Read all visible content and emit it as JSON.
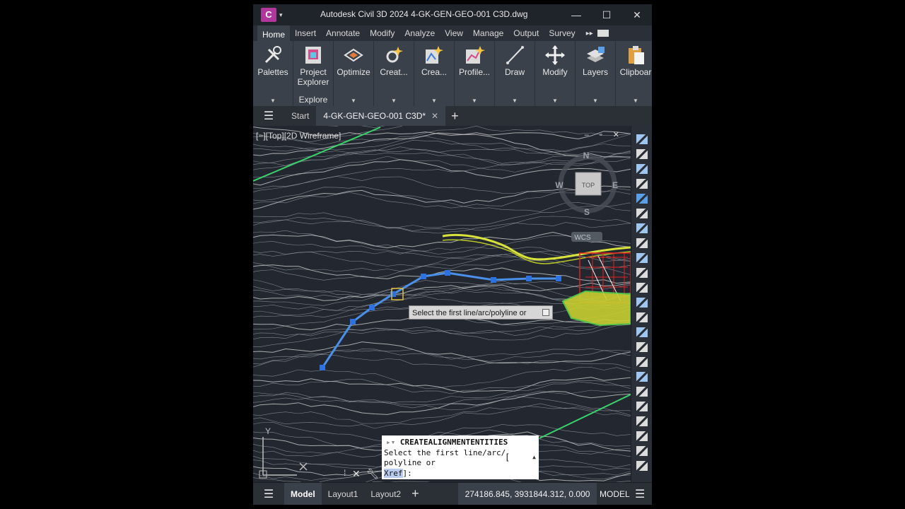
{
  "app": {
    "logo_letter": "C",
    "title": "Autodesk Civil 3D 2024   4-GK-GEN-GEO-001 C3D.dwg",
    "brand_color": "#b0389c"
  },
  "window_controls": {
    "minimize": "—",
    "maximize": "☐",
    "close": "✕"
  },
  "ribbon_tabs": [
    "Home",
    "Insert",
    "Annotate",
    "Modify",
    "Analyze",
    "View",
    "Manage",
    "Output",
    "Survey"
  ],
  "ribbon_more": "▸▸",
  "ribbon_buttons": [
    {
      "label": "Palettes",
      "icon": "tools-icon"
    },
    {
      "label": "Project\nExplorer",
      "icon": "project-explorer-icon",
      "panel": "Explore"
    },
    {
      "label": "Optimize",
      "icon": "optimize-icon"
    },
    {
      "label": "Creat...",
      "icon": "create-ground-data-icon"
    },
    {
      "label": "Crea...",
      "icon": "create-design-icon"
    },
    {
      "label": "Profile...",
      "icon": "profile-icon"
    },
    {
      "label": "Draw",
      "icon": "draw-icon"
    },
    {
      "label": "Modify",
      "icon": "move-icon"
    },
    {
      "label": "Layers",
      "icon": "layers-icon"
    },
    {
      "label": "Clipboar",
      "icon": "clipboard-icon"
    }
  ],
  "file_tabs": {
    "start": "Start",
    "active": "4-GK-GEN-GEO-001 C3D*",
    "close": "✕",
    "new": "+"
  },
  "viewport": {
    "label": "[−][Top][2D Wireframe]",
    "controls": "–  ▫  ✕",
    "viewcube": {
      "top": "TOP",
      "n": "N",
      "s": "S",
      "e": "E",
      "w": "W",
      "wcs": "WCS"
    },
    "ucs_y": "Y"
  },
  "tooltip": "Select the first line/arc/polyline or",
  "command": {
    "name": "CREATEALIGNMENTENTITIES",
    "line1": "Select the first line/arc/",
    "line2": "polyline or",
    "keyword": "Xref",
    "line3_suffix": "]:",
    "cursor": "["
  },
  "status": {
    "model": "Model",
    "layout1": "Layout1",
    "layout2": "Layout2",
    "add": "+",
    "coordinates": "274186.845, 3931844.312, 0.000",
    "space": "MODEL"
  },
  "colors": {
    "alignment": "#4a8fe8",
    "road": "#d8e23a",
    "site": "#e02020",
    "boundary": "#3ad26a"
  }
}
